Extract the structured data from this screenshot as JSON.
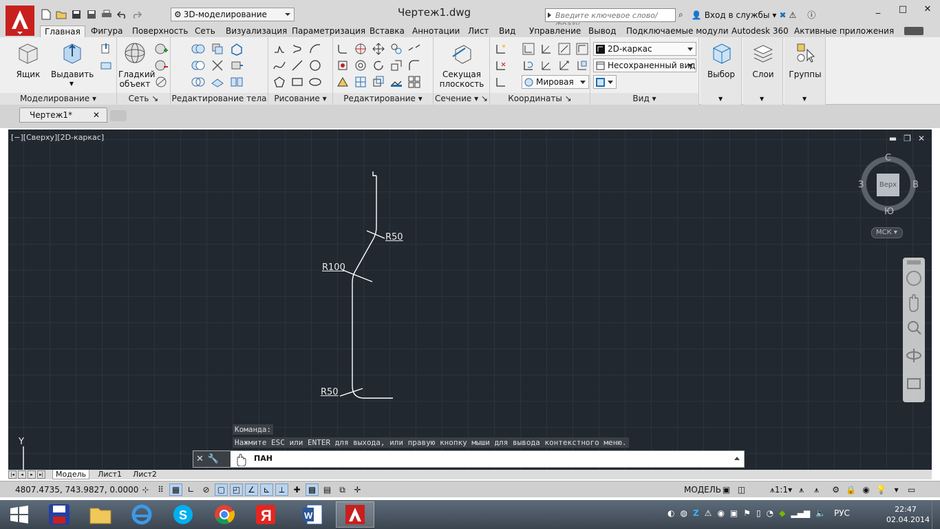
{
  "window": {
    "title": "Чертеж1.dwg",
    "workspace": "3D-моделирование",
    "search_placeholder": "Введите ключевое слово/фразу",
    "signin": "Вход в службы",
    "controls": [
      "_",
      "□",
      "✕"
    ]
  },
  "ribbon_tabs": [
    "Главная",
    "Фигура",
    "Поверхность",
    "Сеть",
    "Визуализация",
    "Параметризация",
    "Вставка",
    "Аннотации",
    "Лист",
    "Вид",
    "Управление",
    "Вывод",
    "Подключаемые модули",
    "Autodesk 360",
    "Активные приложения"
  ],
  "panels": {
    "modeling": {
      "title": "Моделирование",
      "box": "Ящик",
      "extrude": "Выдавить"
    },
    "mesh": {
      "title": "Сеть",
      "smooth_line1": "Гладкий",
      "smooth_line2": "объект"
    },
    "solid_edit": {
      "title": "Редактирование тела"
    },
    "draw": {
      "title": "Рисование"
    },
    "modify": {
      "title": "Редактирование"
    },
    "section": {
      "title": "Сечение",
      "plane_line1": "Секущая",
      "plane_line2": "плоскость"
    },
    "coordinates": {
      "title": "Координаты",
      "world": "Мировая"
    },
    "view": {
      "title": "Вид",
      "visual_style": "2D-каркас",
      "saved_view": "Несохраненный вид"
    },
    "selection": {
      "label": "Выбор"
    },
    "layers": {
      "label": "Слои"
    },
    "groups": {
      "label": "Группы"
    }
  },
  "doc_tab": {
    "name": "Чертеж1*",
    "close": "✕"
  },
  "viewport": {
    "label": "[−][Сверху][2D-каркас]",
    "controls": [
      "▬",
      "❐",
      "✕"
    ],
    "dims": {
      "r50_top": "R50",
      "r100": "R100",
      "r50_bottom": "R50"
    },
    "viewcube": {
      "north": "С",
      "south": "Ю",
      "west": "З",
      "east": "В",
      "top": "Верх"
    },
    "ucs_badge": "МСК",
    "ucs_axis": "Y"
  },
  "command": {
    "history": [
      "Команда:",
      "Нажмите ESC или ENTER для выхода, или правую кнопку мыши для вывода контекстного меню."
    ],
    "current": "ПАН"
  },
  "layouts": {
    "tabs": [
      "Модель",
      "Лист1",
      "Лист2"
    ],
    "active": 0
  },
  "status": {
    "coords": "4807.4735, 743.9827, 0.0000",
    "model": "МОДЕЛЬ",
    "scale": "1:1"
  },
  "taskbar": {
    "clock_time": "22:47",
    "clock_date": "02.04.2014",
    "lang": "РУС",
    "apps": [
      "start-icon",
      "save-app-icon",
      "explorer-icon",
      "ie-icon",
      "skype-icon",
      "chrome-icon",
      "yandex-icon",
      "word-icon",
      "autocad-icon"
    ]
  },
  "colors": {
    "viewport_bg": "#212830",
    "grid": "#2c3440",
    "geometry": "#ffffff",
    "acad_red": "#c8201e"
  }
}
